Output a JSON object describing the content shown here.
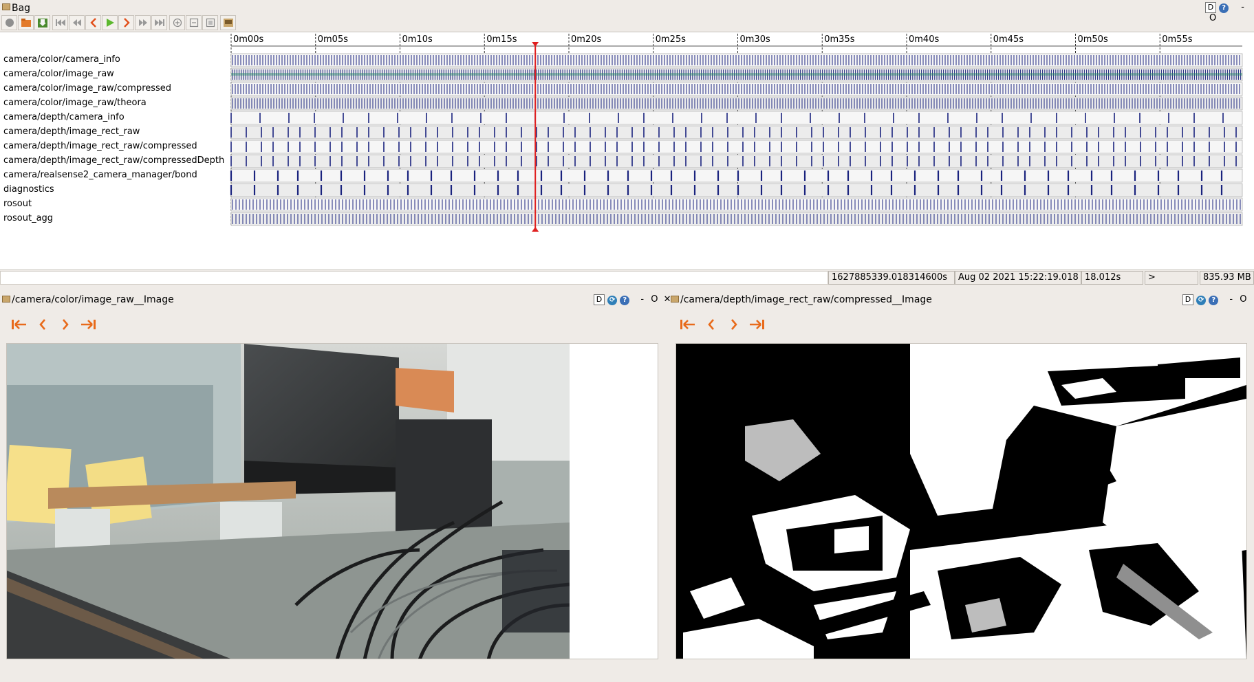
{
  "window": {
    "title": "Bag",
    "d_label": "D",
    "help_label": "?",
    "minimize_label": "-",
    "restore_label": "O"
  },
  "toolbar": {
    "icons": [
      "record-icon",
      "open-icon",
      "save-icon",
      "skip-to-start-icon",
      "rewind-icon",
      "step-back-icon",
      "play-icon",
      "step-forward-icon",
      "fast-forward-icon",
      "skip-to-end-icon",
      "zoom-in-icon",
      "zoom-out-icon",
      "zoom-fit-icon",
      "thumbnails-icon"
    ]
  },
  "timeline": {
    "tick_labels": [
      "0m00s",
      "0m05s",
      "0m10s",
      "0m15s",
      "0m20s",
      "0m25s",
      "0m30s",
      "0m35s",
      "0m40s",
      "0m45s",
      "0m50s",
      "0m55s"
    ],
    "playhead_seconds": 18.012,
    "playhead_color": "#e02020",
    "message_color": "#1a237e",
    "topics": [
      "camera/color/camera_info",
      "camera/color/image_raw",
      "camera/color/image_raw/compressed",
      "camera/color/image_raw/theora",
      "camera/depth/camera_info",
      "camera/depth/image_rect_raw",
      "camera/depth/image_rect_raw/compressed",
      "camera/depth/image_rect_raw/compressedDepth",
      "camera/realsense2_camera_manager/bond",
      "diagnostics",
      "rosout",
      "rosout_agg"
    ]
  },
  "status": {
    "message": "",
    "stamp": "1627885339.018314600s",
    "date": "Aug 02 2021 15:22:19.018",
    "elapsed": "18.012s",
    "play_state": ">",
    "size": "835.93 MB"
  },
  "panels": {
    "left": {
      "title": "/camera/color/image_raw__Image",
      "d_label": "D",
      "minimize_label": "-",
      "restore_label": "O",
      "close_label": "✕"
    },
    "right": {
      "title": "/camera/depth/image_rect_raw/compressed__Image",
      "d_label": "D",
      "minimize_label": "-",
      "restore_label": "O"
    }
  }
}
